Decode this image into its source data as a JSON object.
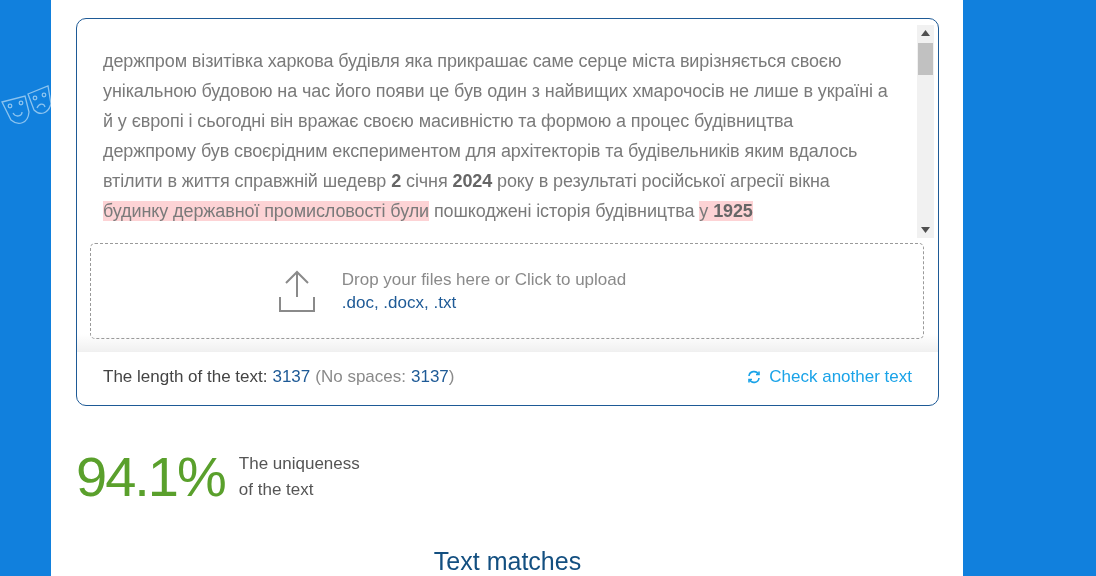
{
  "text_input": {
    "segments": [
      {
        "text": "держпром візитівка харкова будівля яка прикрашає саме серце міста вирізняється своєю унікальною будовою на час його появи це був один з найвищих хмарочосів не лише в україні а й у європі і сьогодні він вражає своєю масивністю та формою а процес будівництва держпрому був своєрідним експериментом для архітекторів та будівельників яким вдалось втілити в життя справжній шедевр ",
        "highlighted": false,
        "bold": false
      },
      {
        "text": "2",
        "highlighted": false,
        "bold": true
      },
      {
        "text": " січня ",
        "highlighted": false,
        "bold": false
      },
      {
        "text": "2024",
        "highlighted": false,
        "bold": true
      },
      {
        "text": " року в результаті російської агресії вікна ",
        "highlighted": false,
        "bold": false
      },
      {
        "text": "будинку державної промисловості були",
        "highlighted": true,
        "bold": false
      },
      {
        "text": " пошкоджені історія будівництва ",
        "highlighted": false,
        "bold": false
      },
      {
        "text": "у ",
        "highlighted": true,
        "bold": false
      },
      {
        "text": "1925",
        "highlighted": true,
        "bold": true
      }
    ]
  },
  "upload": {
    "prompt": "Drop your files here or Click to upload",
    "formats": ".doc, .docx, .txt"
  },
  "footer": {
    "length_label": "The length of the text:",
    "length_value": "3137",
    "no_spaces_open": "(No spaces:",
    "no_spaces_value": "3137",
    "no_spaces_close": ")",
    "check_another": "Check another text"
  },
  "result": {
    "percent": "94.1%",
    "caption_line_1": "The uniqueness",
    "caption_line_2": "of the text"
  },
  "matches_title": "Text matches"
}
